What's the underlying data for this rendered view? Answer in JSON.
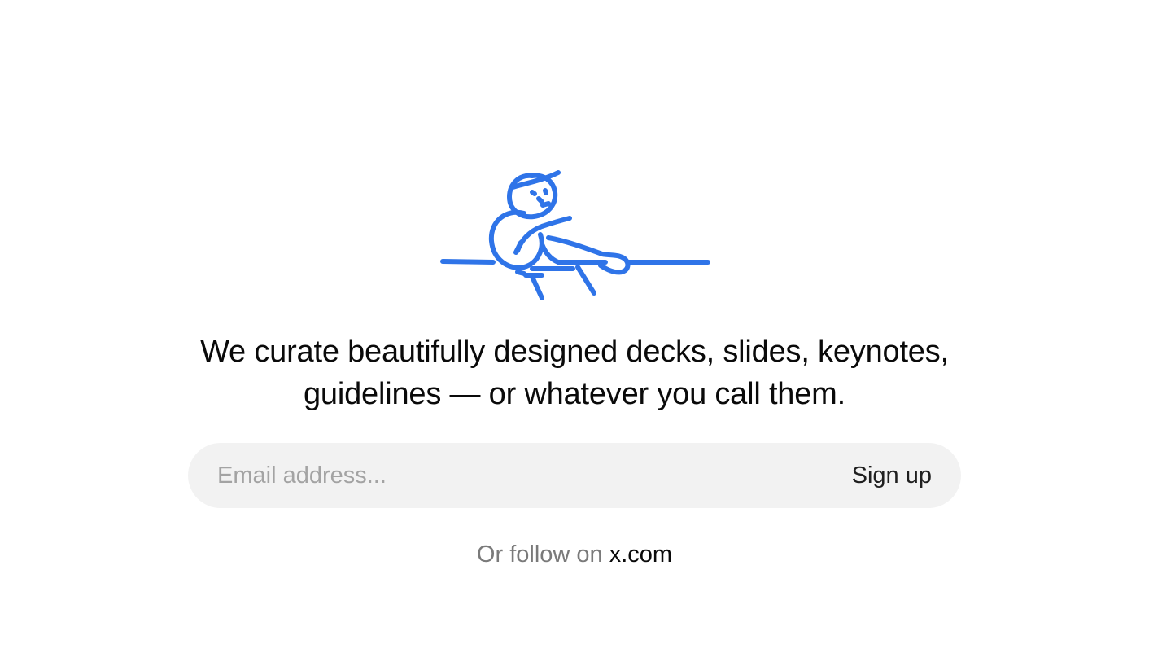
{
  "illustration": {
    "icon": "thinking-person-at-desk-icon",
    "stroke_color": "#2f74e8"
  },
  "headline": {
    "line1": "We curate beautifully designed decks, slides, keynotes,",
    "line2": "guidelines — or whatever you call them."
  },
  "signup": {
    "email_placeholder": "Email address...",
    "email_value": "",
    "submit_label": "Sign up"
  },
  "follow": {
    "prefix": "Or follow on ",
    "link_label": "x.com"
  }
}
